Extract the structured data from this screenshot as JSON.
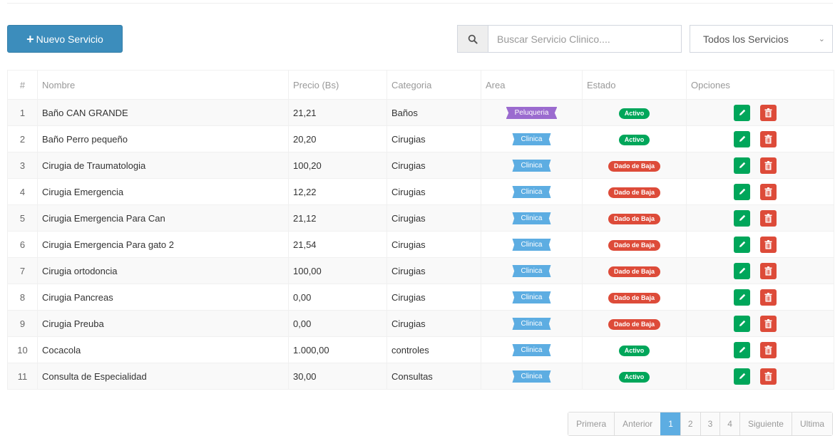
{
  "toolbar": {
    "new_label": "Nuevo Servicio"
  },
  "search": {
    "placeholder": "Buscar Servicio Clinico....",
    "value": ""
  },
  "filter": {
    "selected": "Todos los Servicios"
  },
  "table": {
    "headers": {
      "num": "#",
      "name": "Nombre",
      "price": "Precio (Bs)",
      "category": "Categoria",
      "area": "Area",
      "status": "Estado",
      "options": "Opciones"
    },
    "rows": [
      {
        "num": "1",
        "name": "Baño CAN GRANDE",
        "price": "21,21",
        "category": "Baños",
        "area": "Peluqueria",
        "status": "Activo"
      },
      {
        "num": "2",
        "name": "Baño Perro pequeño",
        "price": "20,20",
        "category": "Cirugias",
        "area": "Clinica",
        "status": "Activo"
      },
      {
        "num": "3",
        "name": "Cirugia de Traumatologia",
        "price": "100,20",
        "category": "Cirugias",
        "area": "Clinica",
        "status": "Dado de Baja"
      },
      {
        "num": "4",
        "name": "Cirugia Emergencia",
        "price": "12,22",
        "category": "Cirugias",
        "area": "Clinica",
        "status": "Dado de Baja"
      },
      {
        "num": "5",
        "name": "Cirugia Emergencia Para Can",
        "price": "21,12",
        "category": "Cirugias",
        "area": "Clinica",
        "status": "Dado de Baja"
      },
      {
        "num": "6",
        "name": "Cirugia Emergencia Para gato 2",
        "price": "21,54",
        "category": "Cirugias",
        "area": "Clinica",
        "status": "Dado de Baja"
      },
      {
        "num": "7",
        "name": "Cirugia ortodoncia",
        "price": "100,00",
        "category": "Cirugias",
        "area": "Clinica",
        "status": "Dado de Baja"
      },
      {
        "num": "8",
        "name": "Cirugia Pancreas",
        "price": "0,00",
        "category": "Cirugias",
        "area": "Clinica",
        "status": "Dado de Baja"
      },
      {
        "num": "9",
        "name": "Cirugia Preuba",
        "price": "0,00",
        "category": "Cirugias",
        "area": "Clinica",
        "status": "Dado de Baja"
      },
      {
        "num": "10",
        "name": "Cocacola",
        "price": "1.000,00",
        "category": "controles",
        "area": "Clinica",
        "status": "Activo"
      },
      {
        "num": "11",
        "name": "Consulta de Especialidad",
        "price": "30,00",
        "category": "Consultas",
        "area": "Clinica",
        "status": "Activo"
      }
    ]
  },
  "pagination": {
    "first": "Primera",
    "prev": "Anterior",
    "pages": [
      "1",
      "2",
      "3",
      "4"
    ],
    "active_page": "1",
    "next": "Siguiente",
    "last": "Ultima"
  },
  "colors": {
    "primary": "#3c8dbc",
    "active_green": "#00a65a",
    "inactive_red": "#dd4b39",
    "area_purple": "#9b6bcf",
    "area_blue": "#5dade2"
  },
  "icons": {
    "new": "plus-icon",
    "search": "search-icon",
    "dropdown": "chevron-down-icon",
    "edit": "pencil-icon",
    "delete": "trash-icon"
  }
}
